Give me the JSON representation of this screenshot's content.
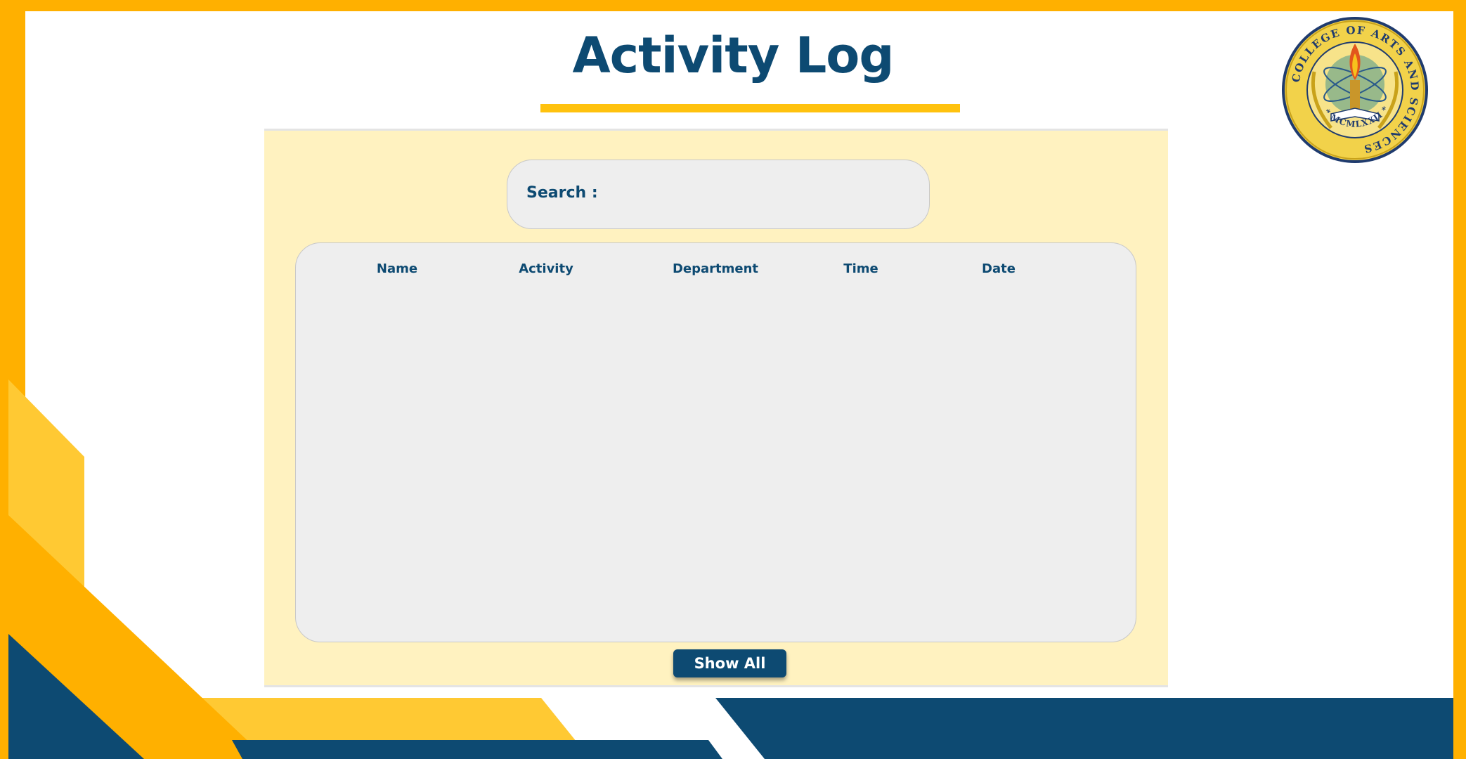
{
  "page": {
    "title": "Activity Log"
  },
  "seal": {
    "ring_text": "COLLEGE OF ARTS AND SCIENCES",
    "year_text": "* MCMLXXII *"
  },
  "search": {
    "label": "Search :",
    "value": "",
    "placeholder": ""
  },
  "table": {
    "columns": [
      "Name",
      "Activity",
      "Department",
      "Time",
      "Date"
    ],
    "rows": []
  },
  "actions": {
    "show_all_label": "Show All"
  },
  "colors": {
    "navy": "#0d4a72",
    "gold": "#ffc20e",
    "amber": "#ffb000",
    "light_gold": "#ffc933",
    "panel": "#fff2c0",
    "card": "#eeeeee"
  }
}
